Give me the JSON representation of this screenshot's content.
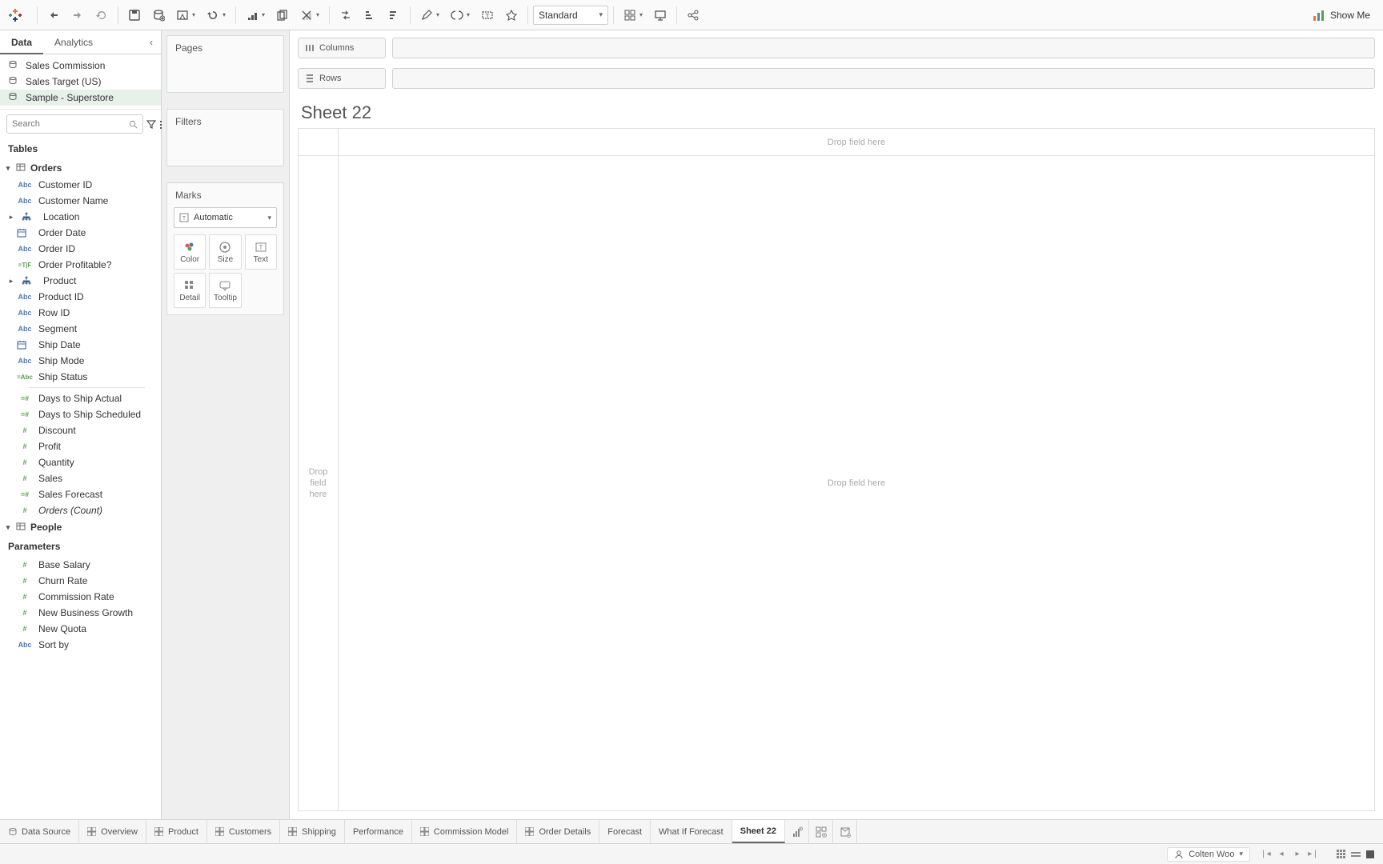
{
  "toolbar": {
    "fit_mode": "Standard",
    "showme_label": "Show Me"
  },
  "data_pane": {
    "tabs": {
      "data": "Data",
      "analytics": "Analytics"
    },
    "data_sources": [
      {
        "name": "Sales Commission",
        "selected": false
      },
      {
        "name": "Sales Target (US)",
        "selected": false
      },
      {
        "name": "Sample - Superstore",
        "selected": true
      }
    ],
    "search_placeholder": "Search",
    "tables_header": "Tables",
    "tables": [
      {
        "name": "Orders",
        "fields": [
          {
            "label": "Customer ID",
            "icon": "Abc",
            "kind": "dim"
          },
          {
            "label": "Customer Name",
            "icon": "Abc",
            "kind": "dim"
          },
          {
            "label": "Location",
            "icon": "hier",
            "kind": "dim",
            "expandable": true
          },
          {
            "label": "Order Date",
            "icon": "date",
            "kind": "dim"
          },
          {
            "label": "Order ID",
            "icon": "Abc",
            "kind": "dim"
          },
          {
            "label": "Order Profitable?",
            "icon": "=T|F",
            "kind": "calc"
          },
          {
            "label": "Product",
            "icon": "hier",
            "kind": "dim",
            "expandable": true
          },
          {
            "label": "Product ID",
            "icon": "Abc",
            "kind": "dim"
          },
          {
            "label": "Row ID",
            "icon": "Abc",
            "kind": "dim"
          },
          {
            "label": "Segment",
            "icon": "Abc",
            "kind": "dim"
          },
          {
            "label": "Ship Date",
            "icon": "date",
            "kind": "dim"
          },
          {
            "label": "Ship Mode",
            "icon": "Abc",
            "kind": "dim"
          },
          {
            "label": "Ship Status",
            "icon": "=Abc",
            "kind": "calc"
          },
          {
            "divider": true
          },
          {
            "label": "Days to Ship Actual",
            "icon": "=#",
            "kind": "meas"
          },
          {
            "label": "Days to Ship Scheduled",
            "icon": "=#",
            "kind": "meas"
          },
          {
            "label": "Discount",
            "icon": "#",
            "kind": "meas"
          },
          {
            "label": "Profit",
            "icon": "#",
            "kind": "meas"
          },
          {
            "label": "Quantity",
            "icon": "#",
            "kind": "meas"
          },
          {
            "label": "Sales",
            "icon": "#",
            "kind": "meas"
          },
          {
            "label": "Sales Forecast",
            "icon": "=#",
            "kind": "meas"
          },
          {
            "label": "Orders (Count)",
            "icon": "#",
            "kind": "meas",
            "italic": true
          }
        ]
      },
      {
        "name": "People",
        "fields": []
      }
    ],
    "parameters_header": "Parameters",
    "parameters": [
      {
        "label": "Base Salary",
        "icon": "#",
        "kind": "meas"
      },
      {
        "label": "Churn Rate",
        "icon": "#",
        "kind": "meas"
      },
      {
        "label": "Commission Rate",
        "icon": "#",
        "kind": "meas"
      },
      {
        "label": "New Business Growth",
        "icon": "#",
        "kind": "meas"
      },
      {
        "label": "New Quota",
        "icon": "#",
        "kind": "meas"
      },
      {
        "label": "Sort by",
        "icon": "Abc",
        "kind": "dim"
      }
    ]
  },
  "shelves": {
    "pages": "Pages",
    "filters": "Filters",
    "marks": "Marks",
    "mark_type": "Automatic",
    "mark_cells": [
      "Color",
      "Size",
      "Text",
      "Detail",
      "Tooltip"
    ]
  },
  "worksheet": {
    "columns_label": "Columns",
    "rows_label": "Rows",
    "sheet_title": "Sheet 22",
    "drop_col": "Drop field here",
    "drop_row": "Drop\nfield\nhere",
    "drop_body": "Drop field here"
  },
  "sheet_tabs": {
    "data_source": "Data Source",
    "tabs": [
      {
        "label": "Overview",
        "type": "dashboard"
      },
      {
        "label": "Product",
        "type": "dashboard"
      },
      {
        "label": "Customers",
        "type": "dashboard"
      },
      {
        "label": "Shipping",
        "type": "dashboard"
      },
      {
        "label": "Performance",
        "type": "worksheet"
      },
      {
        "label": "Commission Model",
        "type": "dashboard"
      },
      {
        "label": "Order Details",
        "type": "dashboard"
      },
      {
        "label": "Forecast",
        "type": "worksheet"
      },
      {
        "label": "What If Forecast",
        "type": "worksheet"
      },
      {
        "label": "Sheet 22",
        "type": "worksheet",
        "active": true
      }
    ]
  },
  "status": {
    "user": "Colten Woo"
  }
}
